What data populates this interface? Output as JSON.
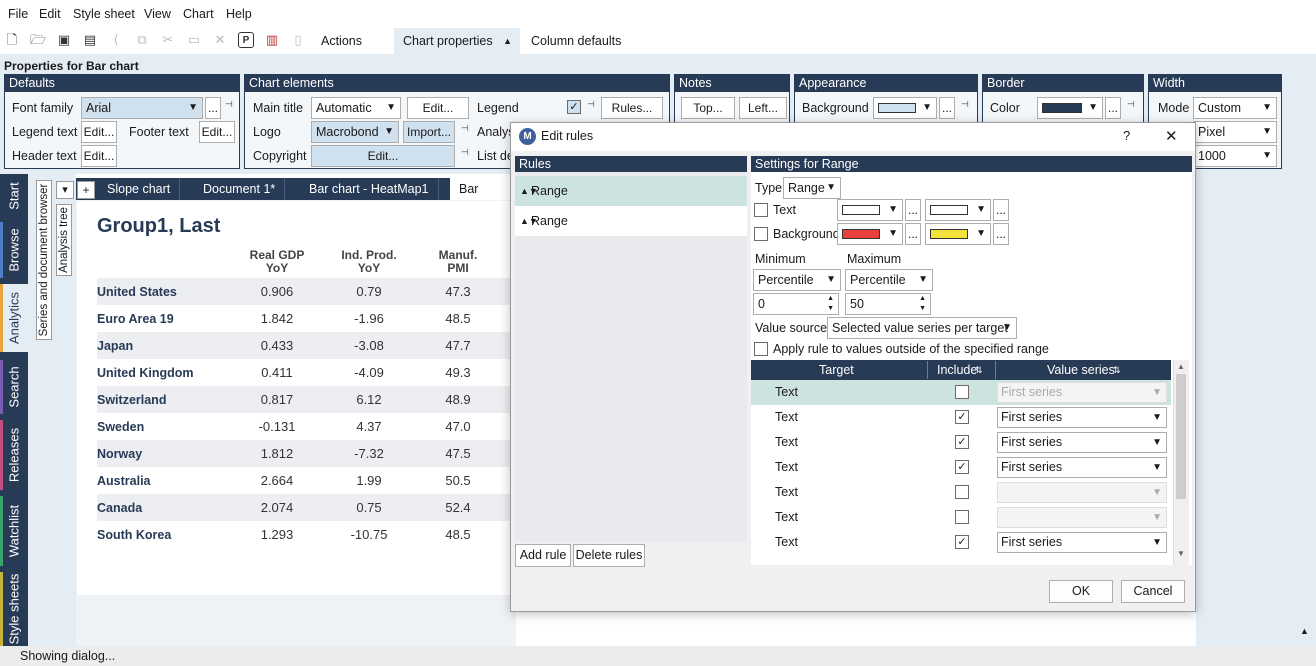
{
  "menu": [
    "File",
    "Edit",
    "Style sheet",
    "View",
    "Chart",
    "Help"
  ],
  "toolbar": {
    "tabs": [
      "Actions",
      "Chart properties",
      "Column defaults"
    ]
  },
  "props": {
    "title": "Properties for Bar chart",
    "defaults": {
      "header": "Defaults",
      "font_family_label": "Font family",
      "font_family_value": "Arial",
      "legend_text_label": "Legend text",
      "footer_text_label": "Footer text",
      "header_text_label": "Header text",
      "edit": "Edit...",
      "more": "..."
    },
    "chart_elements": {
      "header": "Chart elements",
      "main_title_label": "Main title",
      "main_title_value": "Automatic",
      "logo_label": "Logo",
      "logo_value": "Macrobond",
      "import": "Import...",
      "copyright_label": "Copyright",
      "legend_label": "Legend",
      "rules": "Rules...",
      "analysis_label": "Analys",
      "list_label": "List de",
      "edit": "Edit..."
    },
    "notes": {
      "header": "Notes",
      "top": "Top...",
      "left": "Left..."
    },
    "appearance": {
      "header": "Appearance",
      "background_label": "Background"
    },
    "border": {
      "header": "Border",
      "color_label": "Color"
    },
    "width": {
      "header": "Width",
      "mode_label": "Mode",
      "mode_value": "Custom",
      "unit_value": "Pixel",
      "size_value": "1000"
    }
  },
  "left_tabs": [
    "Start",
    "Browse",
    "Analytics",
    "Search",
    "Releases",
    "Watchlist",
    "Style sheets"
  ],
  "sidebar_labels": [
    "Series and document browser",
    "Analysis tree"
  ],
  "doc_tabs": {
    "dropdown": "▾",
    "add": "+",
    "tabs": [
      "Slope chart",
      "Document 1*",
      "Bar chart - HeatMap1",
      "Bar chart"
    ]
  },
  "sheet": {
    "title": "Group1, Last",
    "columns": [
      [
        "Real GDP",
        "YoY"
      ],
      [
        "Ind. Prod.",
        "YoY"
      ],
      [
        "Manuf.",
        "PMI"
      ]
    ],
    "rows": [
      {
        "country": "United States",
        "v": [
          "0.906",
          "0.79",
          "47.3"
        ]
      },
      {
        "country": "Euro Area 19",
        "v": [
          "1.842",
          "-1.96",
          "48.5"
        ]
      },
      {
        "country": "Japan",
        "v": [
          "0.433",
          "-3.08",
          "47.7"
        ]
      },
      {
        "country": "United Kingdom",
        "v": [
          "0.411",
          "-4.09",
          "49.3"
        ]
      },
      {
        "country": "Switzerland",
        "v": [
          "0.817",
          "6.12",
          "48.9"
        ]
      },
      {
        "country": "Sweden",
        "v": [
          "-0.131",
          "4.37",
          "47.0"
        ]
      },
      {
        "country": "Norway",
        "v": [
          "1.812",
          "-7.32",
          "47.5"
        ]
      },
      {
        "country": "Australia",
        "v": [
          "2.664",
          "1.99",
          "50.5"
        ]
      },
      {
        "country": "Canada",
        "v": [
          "2.074",
          "0.75",
          "52.4"
        ]
      },
      {
        "country": "South Korea",
        "v": [
          "1.293",
          "-10.75",
          "48.5"
        ]
      }
    ]
  },
  "status": "Showing dialog...",
  "dialog": {
    "title": "Edit rules",
    "logo": "M",
    "help": "?",
    "close": "✕",
    "rules_header": "Rules",
    "rules": [
      "Range",
      "Range"
    ],
    "add_rule": "Add rule",
    "delete_rules": "Delete rules",
    "settings_header": "Settings for Range",
    "type_label": "Type",
    "type_value": "Range",
    "text_label": "Text",
    "background_label": "Background",
    "minimum_label": "Minimum",
    "maximum_label": "Maximum",
    "min_mode": "Percentile",
    "max_mode": "Percentile",
    "min_value": "0",
    "max_value": "50",
    "value_source_label": "Value source",
    "value_source_value": "Selected value series per target",
    "apply_outside_label": "Apply rule to values outside of the specified range",
    "target_header": "Target",
    "include_header": "Include",
    "value_series_header": "Value series",
    "targets": [
      {
        "target": "Text",
        "include": false,
        "series": "First series",
        "disabled": true
      },
      {
        "target": "Text",
        "include": true,
        "series": "First series",
        "disabled": false
      },
      {
        "target": "Text",
        "include": true,
        "series": "First series",
        "disabled": false
      },
      {
        "target": "Text",
        "include": true,
        "series": "First series",
        "disabled": false
      },
      {
        "target": "Text",
        "include": false,
        "series": "",
        "disabled": true
      },
      {
        "target": "Text",
        "include": false,
        "series": "",
        "disabled": true
      },
      {
        "target": "Text",
        "include": true,
        "series": "First series",
        "disabled": false
      }
    ],
    "ok": "OK",
    "cancel": "Cancel",
    "colors": {
      "text_fg": "#ffffff",
      "text_bg": "#ffffff",
      "bg_low": "#e8413c",
      "bg_high": "#f2e23a",
      "appearance_bg": "#cfe0ee",
      "border_color": "#273a56"
    }
  }
}
